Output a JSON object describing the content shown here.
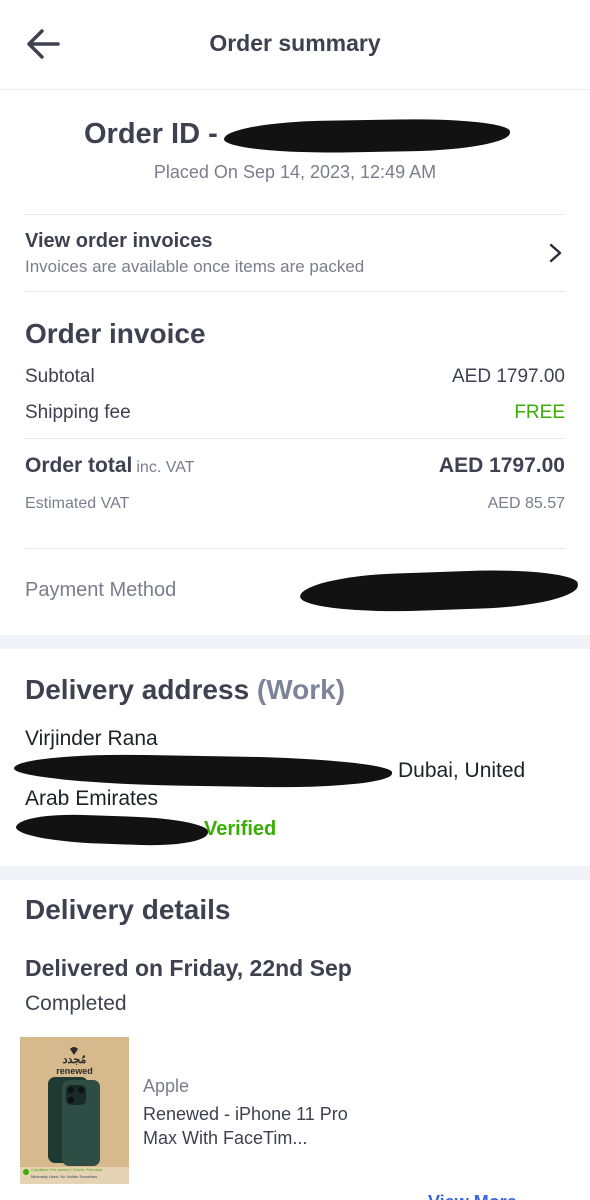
{
  "header": {
    "title": "Order summary",
    "back_icon": "arrow-left-icon"
  },
  "order": {
    "id_label": "Order ID -",
    "placed_on": "Placed On Sep 14, 2023, 12:49 AM"
  },
  "invoices": {
    "title": "View order invoices",
    "subtitle": "Invoices are available once items are packed",
    "icon": "chevron-right-icon"
  },
  "invoice": {
    "title": "Order invoice",
    "subtotal_label": "Subtotal",
    "subtotal_value": "AED 1797.00",
    "shipping_label": "Shipping fee",
    "shipping_value": "FREE",
    "total_label": "Order total",
    "total_sub": "inc. VAT",
    "total_value": "AED 1797.00",
    "vat_label": "Estimated VAT",
    "vat_value": "AED 85.57",
    "payment_label": "Payment Method"
  },
  "address": {
    "title": "Delivery address",
    "type": "(Work)",
    "name": "Virjinder Rana",
    "line1_visible": "Dubai, United",
    "line2": "Arab Emirates",
    "verified": "Verified"
  },
  "delivery": {
    "title": "Delivery details",
    "delivered_on": "Delivered on Friday, 22nd Sep",
    "status": "Completed"
  },
  "product": {
    "brand": "Apple",
    "name": "Renewed - iPhone 11 Pro Max With FaceTim...",
    "thumb_badge_text": "renewed",
    "thumb_badge_arabic": "مُجدد",
    "thumb_footer": "Condition: Pre-owned / Grade: Premium",
    "thumb_footer2": "Minimally Used, No Visible Scratches"
  },
  "view_more": "View More",
  "colors": {
    "accent_green": "#38ae04",
    "text_dark": "#3d4150",
    "text_muted": "#7a7e8c",
    "section_gap": "#f2f3f8",
    "link_blue": "#3866df"
  }
}
